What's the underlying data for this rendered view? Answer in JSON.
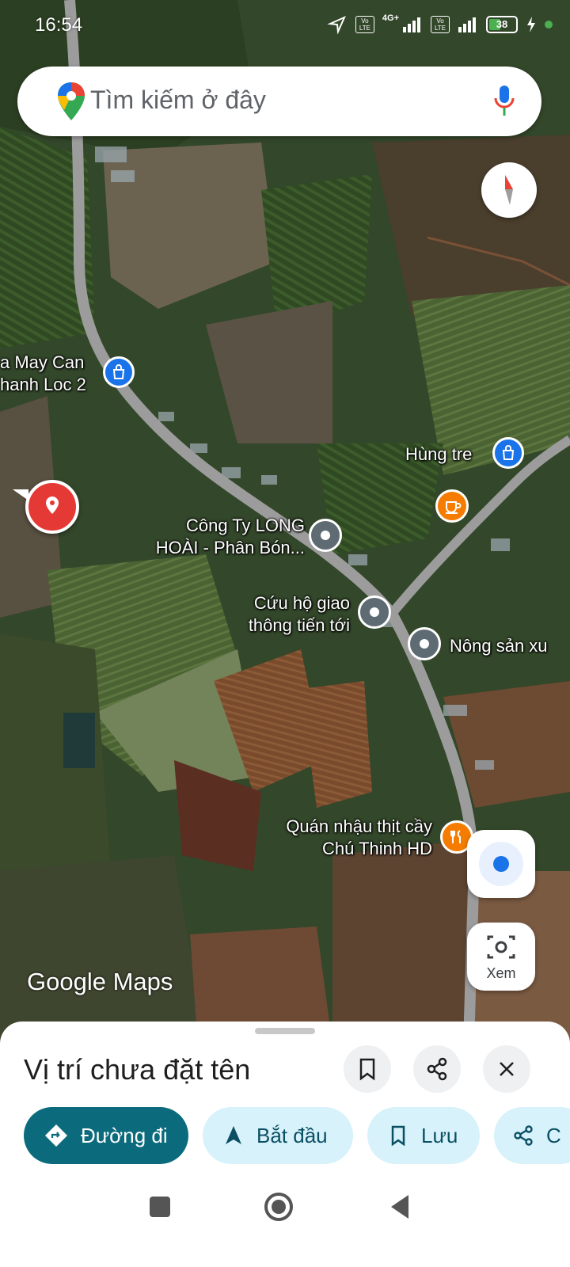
{
  "status_bar": {
    "time": "16:54",
    "signal_1_label": "Vo LTE",
    "network_type": "4G+",
    "signal_2_label": "Vo LTE",
    "battery": "38"
  },
  "search": {
    "placeholder": "Tìm kiếm ở đây"
  },
  "map": {
    "watermark": "Google Maps",
    "places": [
      {
        "name_line1": "a May Can",
        "name_line2": "hanh Loc 2",
        "category": "shopping"
      },
      {
        "name_line1": "Hùng tre",
        "category": "shopping"
      },
      {
        "name_line1": "Công Ty LONG",
        "name_line2": "HOÀI - Phân Bón...",
        "category": "generic"
      },
      {
        "name_line1": "Cứu hộ giao",
        "name_line2": "thông tiến tới",
        "category": "generic"
      },
      {
        "name_line1": "Nông sản xu",
        "category": "generic"
      },
      {
        "name_line1": "Quán nhậu thịt cầy",
        "name_line2": "Chú Thinh HD",
        "category": "restaurant"
      }
    ],
    "cafe_marker": "cafe",
    "dropped_pin": "dropped-pin"
  },
  "controls": {
    "view_button_label": "Xem"
  },
  "sheet": {
    "title": "Vị trí chưa đặt tên",
    "chips": [
      {
        "label": "Đường đi",
        "icon": "directions-icon"
      },
      {
        "label": "Bắt đầu",
        "icon": "navigation-icon"
      },
      {
        "label": "Lưu",
        "icon": "bookmark-icon"
      },
      {
        "label": "C",
        "icon": "share-icon"
      }
    ]
  },
  "colors": {
    "primary_chip": "#0b6b7c",
    "chip_light": "#d7f2fb",
    "pin_red": "#e53935",
    "marker_blue": "#1a73e8",
    "marker_orange": "#f57c00"
  }
}
